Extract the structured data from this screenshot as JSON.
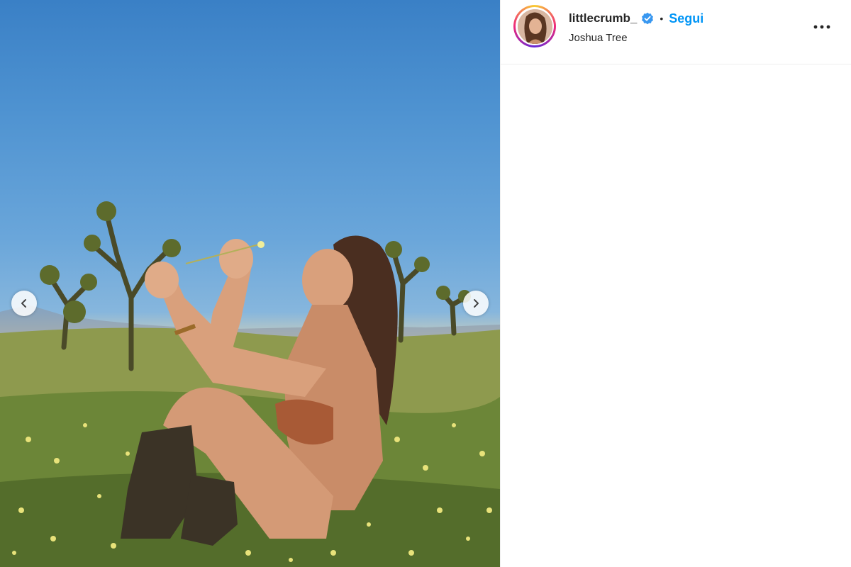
{
  "post": {
    "author": {
      "username": "littlecrumb_",
      "verified": true,
      "follow_label": "Segui",
      "separator": "•",
      "location": "Joshua Tree"
    },
    "media": {
      "carousel": {
        "prev_icon": "chevron-left-icon",
        "next_icon": "chevron-right-icon"
      }
    },
    "more_options_icon": "more-horizontal-icon"
  },
  "colors": {
    "follow_blue": "#0095f6",
    "verified_blue": "#3897f0",
    "text_primary": "#262626",
    "divider": "#efefef"
  }
}
